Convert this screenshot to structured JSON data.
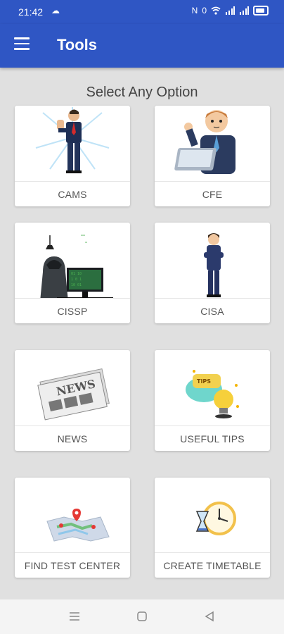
{
  "status": {
    "time": "21:42",
    "app_icon": "cloud-icon",
    "indicators": [
      "N",
      "0",
      "wifi",
      "signal",
      "signal",
      "battery"
    ]
  },
  "appbar": {
    "title": "Tools"
  },
  "subtitle": "Select Any Option",
  "tiles": [
    {
      "label": "CAMS",
      "icon": "businessman-thumbs-up-icon"
    },
    {
      "label": "CFE",
      "icon": "cartoon-businessman-laptop-icon"
    },
    {
      "label": "CISSP",
      "icon": "hacker-at-computer-icon"
    },
    {
      "label": "CISA",
      "icon": "businessman-standing-icon"
    },
    {
      "label": "NEWS",
      "icon": "newspaper-icon"
    },
    {
      "label": "USEFUL TIPS",
      "icon": "lightbulb-tips-icon"
    },
    {
      "label": "FIND TEST CENTER",
      "icon": "map-pins-icon"
    },
    {
      "label": "CREATE TIMETABLE",
      "icon": "clock-hourglass-icon"
    }
  ],
  "colors": {
    "appbar": "#2f56c4",
    "background": "#e0e0e0",
    "card": "#ffffff"
  }
}
